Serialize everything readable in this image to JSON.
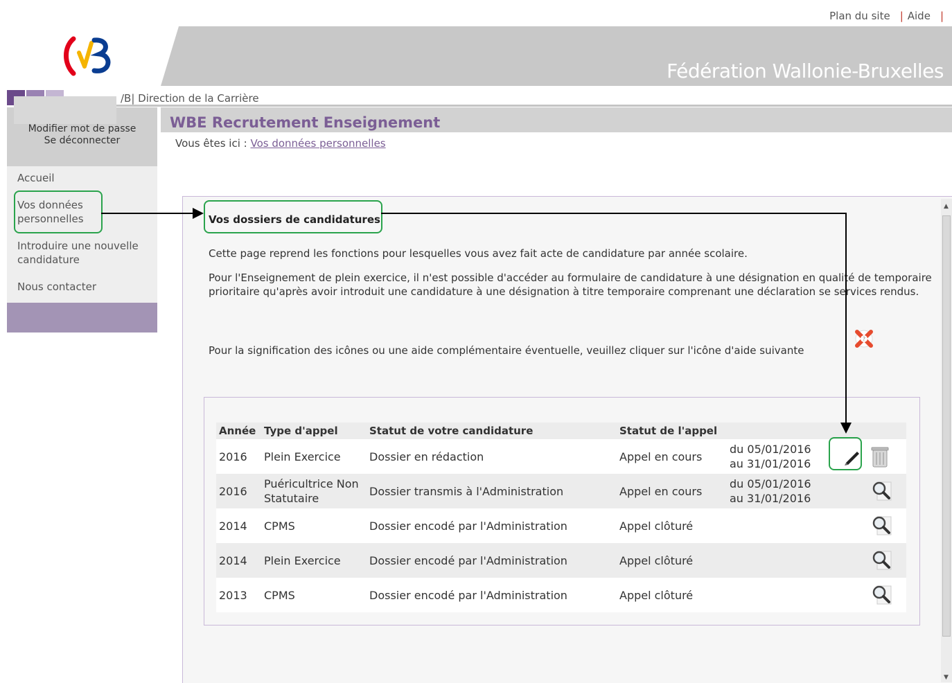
{
  "top_links": {
    "plan": "Plan du site",
    "help": "Aide",
    "sep": "|"
  },
  "header": {
    "title": "Fédération Wallonie-Bruxelles",
    "subbar": "/B| Direction de la Carrière"
  },
  "user_menu": {
    "change_password": "Modifier mot de passe",
    "logout": "Se déconnecter"
  },
  "nav": {
    "items": [
      {
        "label": "Accueil"
      },
      {
        "label": "Vos données personnelles"
      },
      {
        "label": "Introduire une nouvelle candidature"
      },
      {
        "label": "Nous contacter"
      }
    ]
  },
  "page": {
    "title": "WBE Recrutement Enseignement",
    "breadcrumb_prefix": "Vous êtes ici :",
    "breadcrumb_link": "Vos données personnelles"
  },
  "content": {
    "section_title": "Vos dossiers de candidatures",
    "intro": "Cette page reprend les fonctions pour lesquelles vous avez fait acte de candidature par année scolaire.",
    "para2": "Pour l'Enseignement de plein exercice, il n'est possible d'accéder au formulaire de candidature à une désignation en qualité de temporaire prioritaire qu'après avoir introduit une candidature à une désignation à titre temporaire comprenant une déclaration se services rendus.",
    "help_text": "Pour la signification des icônes ou une aide complémentaire éventuelle, veuillez cliquer sur l'icône d'aide suivante"
  },
  "table": {
    "headers": [
      "Année",
      "Type d'appel",
      "Statut de votre candidature",
      "Statut de l'appel",
      ""
    ],
    "rows": [
      {
        "year": "2016",
        "type": "Plein Exercice",
        "status": "Dossier en rédaction",
        "call_status": "Appel en cours",
        "period_from": "du 05/01/2016",
        "period_to": "au 31/01/2016",
        "actions": [
          "edit-pen-icon",
          "trash-icon"
        ]
      },
      {
        "year": "2016",
        "type": "Puéricultrice Non Statutaire",
        "status": "Dossier transmis à l'Administration",
        "call_status": "Appel en cours",
        "period_from": "du 05/01/2016",
        "period_to": "au 31/01/2016",
        "actions": [
          "magnifier-icon"
        ]
      },
      {
        "year": "2014",
        "type": "CPMS",
        "status": "Dossier encodé par l'Administration",
        "call_status": "Appel clôturé",
        "period_from": "",
        "period_to": "",
        "actions": [
          "magnifier-icon"
        ]
      },
      {
        "year": "2014",
        "type": "Plein Exercice",
        "status": "Dossier encodé par l'Administration",
        "call_status": "Appel clôturé",
        "period_from": "",
        "period_to": "",
        "actions": [
          "magnifier-icon"
        ]
      },
      {
        "year": "2013",
        "type": "CPMS",
        "status": "Dossier encodé par l'Administration",
        "call_status": "Appel clôturé",
        "period_from": "",
        "period_to": "",
        "actions": [
          "magnifier-icon"
        ]
      }
    ]
  },
  "colors": {
    "accent": "#7b5e95",
    "annotation": "#2aa34c",
    "header_gray": "#c8c8c8"
  }
}
